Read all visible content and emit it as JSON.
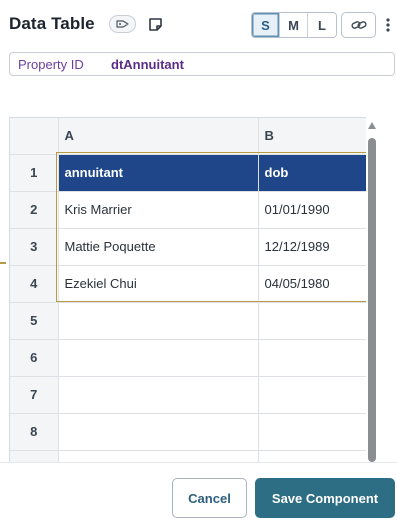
{
  "header": {
    "title": "Data Table",
    "size_options": [
      "S",
      "M",
      "L"
    ],
    "active_size": "S"
  },
  "property": {
    "label": "Property ID",
    "value": "dtAnnuitant"
  },
  "grid": {
    "columns": [
      "A",
      "B"
    ],
    "rows": [
      {
        "num": "1",
        "a": "annuitant",
        "b": "dob"
      },
      {
        "num": "2",
        "a": "Kris Marrier",
        "b": "01/01/1990"
      },
      {
        "num": "3",
        "a": "Mattie Poquette",
        "b": "12/12/1989"
      },
      {
        "num": "4",
        "a": "Ezekiel Chui",
        "b": "04/05/1980"
      },
      {
        "num": "5",
        "a": "",
        "b": ""
      },
      {
        "num": "6",
        "a": "",
        "b": ""
      },
      {
        "num": "7",
        "a": "",
        "b": ""
      },
      {
        "num": "8",
        "a": "",
        "b": ""
      },
      {
        "num": "",
        "a": "",
        "b": ""
      }
    ]
  },
  "footer": {
    "cancel_label": "Cancel",
    "save_label": "Save Component"
  },
  "colors": {
    "header_row": "#1f4688",
    "selection_border": "#b89b45",
    "save_button": "#2d6e84",
    "property_text": "#5a2d86"
  },
  "icons": [
    "tag-icon",
    "note-icon",
    "link-icon",
    "kebab-menu-icon",
    "scroll-up-arrow-icon"
  ]
}
